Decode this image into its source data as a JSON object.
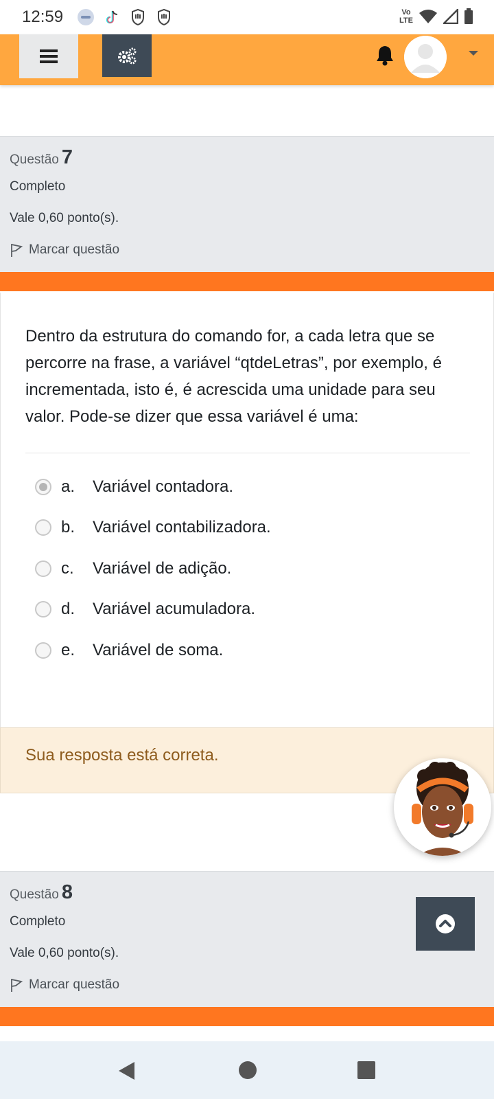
{
  "status_bar": {
    "time": "12:59",
    "volte_top": "Vo",
    "volte_bottom": "LTE"
  },
  "navbar": {
    "menu_icon": "hamburger-icon",
    "settings_icon": "gears-icon",
    "notification_icon": "bell-icon",
    "avatar_icon": "user-avatar",
    "dropdown_icon": "caret-down-icon",
    "accent_color": "#ffa73f"
  },
  "question7": {
    "label": "Questão",
    "number": "7",
    "state": "Completo",
    "grade": "Vale 0,60 ponto(s).",
    "flag_label": "Marcar questão",
    "text": "Dentro da estrutura do comando for, a cada letra que se percorre na frase, a variável “qtdeLetras”, por exemplo, é incrementada, isto é, é acrescida uma unidade para seu valor. Pode-se dizer que essa variável é uma:",
    "answers": [
      {
        "letter": "a.",
        "text": "Variável contadora.",
        "selected": true
      },
      {
        "letter": "b.",
        "text": "Variável contabilizadora.",
        "selected": false
      },
      {
        "letter": "c.",
        "text": "Variável de adição.",
        "selected": false
      },
      {
        "letter": "d.",
        "text": "Variável acumuladora.",
        "selected": false
      },
      {
        "letter": "e.",
        "text": "Variável de soma.",
        "selected": false
      }
    ],
    "feedback": "Sua resposta está correta."
  },
  "question8": {
    "label": "Questão",
    "number": "8",
    "state": "Completo",
    "grade": "Vale 0,60 ponto(s).",
    "flag_label": "Marcar questão"
  },
  "colors": {
    "orange_bar": "#ff761f",
    "info_panel": "#e8eaed",
    "feedback_bg": "#fcefdc",
    "feedback_text": "#8e5c1e",
    "dark_button": "#3e4a56"
  }
}
